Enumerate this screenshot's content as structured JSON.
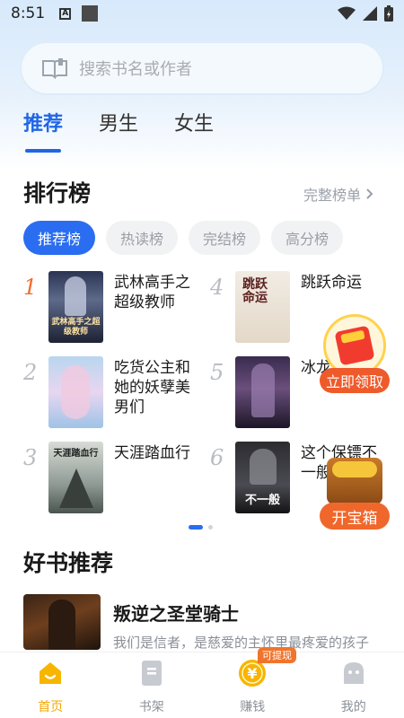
{
  "status": {
    "time": "8:51"
  },
  "search": {
    "placeholder": "搜索书名或作者"
  },
  "tabs": [
    {
      "label": "推荐",
      "active": true
    },
    {
      "label": "男生"
    },
    {
      "label": "女生"
    }
  ],
  "ranking": {
    "title": "排行榜",
    "more_label": "完整榜单",
    "chips": [
      {
        "label": "推荐榜",
        "active": true
      },
      {
        "label": "热读榜"
      },
      {
        "label": "完结榜"
      },
      {
        "label": "高分榜"
      }
    ],
    "books": [
      {
        "rank": "1",
        "name": "武林高手之超级教师",
        "cover_text": "武林高手之超级教师"
      },
      {
        "rank": "2",
        "name": "吃货公主和她的妖孽美男们",
        "cover_text": ""
      },
      {
        "rank": "3",
        "name": "天涯踏血行",
        "cover_text": "天涯踏血行"
      },
      {
        "rank": "4",
        "name": "跳跃命运",
        "cover_text": "跳跃命运"
      },
      {
        "rank": "5",
        "name": "冰龙",
        "cover_text": ""
      },
      {
        "rank": "6",
        "name": "这个保镖不一般",
        "cover_text": "不一般"
      }
    ]
  },
  "good_books": {
    "title": "好书推荐",
    "items": [
      {
        "name": "叛逆之圣堂骑士",
        "desc": "我们是信者，是慈爱的主怀里最疼爱的孩子"
      }
    ]
  },
  "floating": {
    "red_packet_label": "立即领取",
    "treasure_label": "开宝箱"
  },
  "bottom_nav": [
    {
      "label": "首页",
      "icon": "home-icon",
      "active": true
    },
    {
      "label": "书架",
      "icon": "bookshelf-icon"
    },
    {
      "label": "赚钱",
      "icon": "yuan-coin-icon",
      "badge": "可提现"
    },
    {
      "label": "我的",
      "icon": "profile-icon"
    }
  ],
  "colors": {
    "accent": "#2a6df0",
    "rank_first": "#f26a2a",
    "nav_active": "#f5a800",
    "float_button": "#ef5a2b"
  }
}
